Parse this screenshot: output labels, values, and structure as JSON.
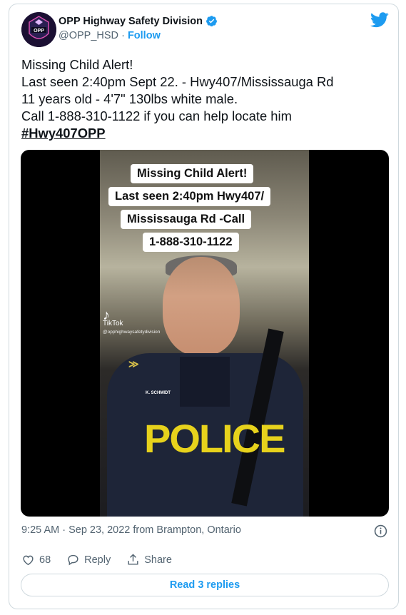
{
  "author": {
    "display_name": "OPP Highway Safety Division",
    "handle": "@OPP_HSD",
    "separator": "·",
    "follow_label": "Follow",
    "avatar_text": "OPP"
  },
  "tweet": {
    "lines": [
      "Missing Child Alert!",
      "Last seen 2:40pm Sept 22. - Hwy407/Mississauga Rd",
      "11 years old - 4'7\" 130lbs white male.",
      "Call 1-888-310-1122 if you can help locate him"
    ],
    "hashtag": "#Hwy407OPP"
  },
  "video": {
    "captions": [
      "Missing Child Alert!",
      "Last seen 2:40pm Hwy407/",
      "Mississauga Rd -Call",
      "1-888-310-1122"
    ],
    "tiktok_label": "TikTok",
    "tiktok_user": "@opphighwaysafetydivision",
    "vest_text": "POLICE",
    "name_tag": "K. SCHMIDT",
    "patch_text": "OPP"
  },
  "meta": {
    "timestamp": "9:25 AM · Sep 23, 2022 from Brampton, Ontario"
  },
  "actions": {
    "like_count": "68",
    "reply_label": "Reply",
    "share_label": "Share"
  },
  "read_replies_label": "Read 3 replies",
  "colors": {
    "accent": "#1d9bf0",
    "secondary_text": "#536471",
    "border": "#cfd9de",
    "vest_text": "#e7d21c"
  }
}
